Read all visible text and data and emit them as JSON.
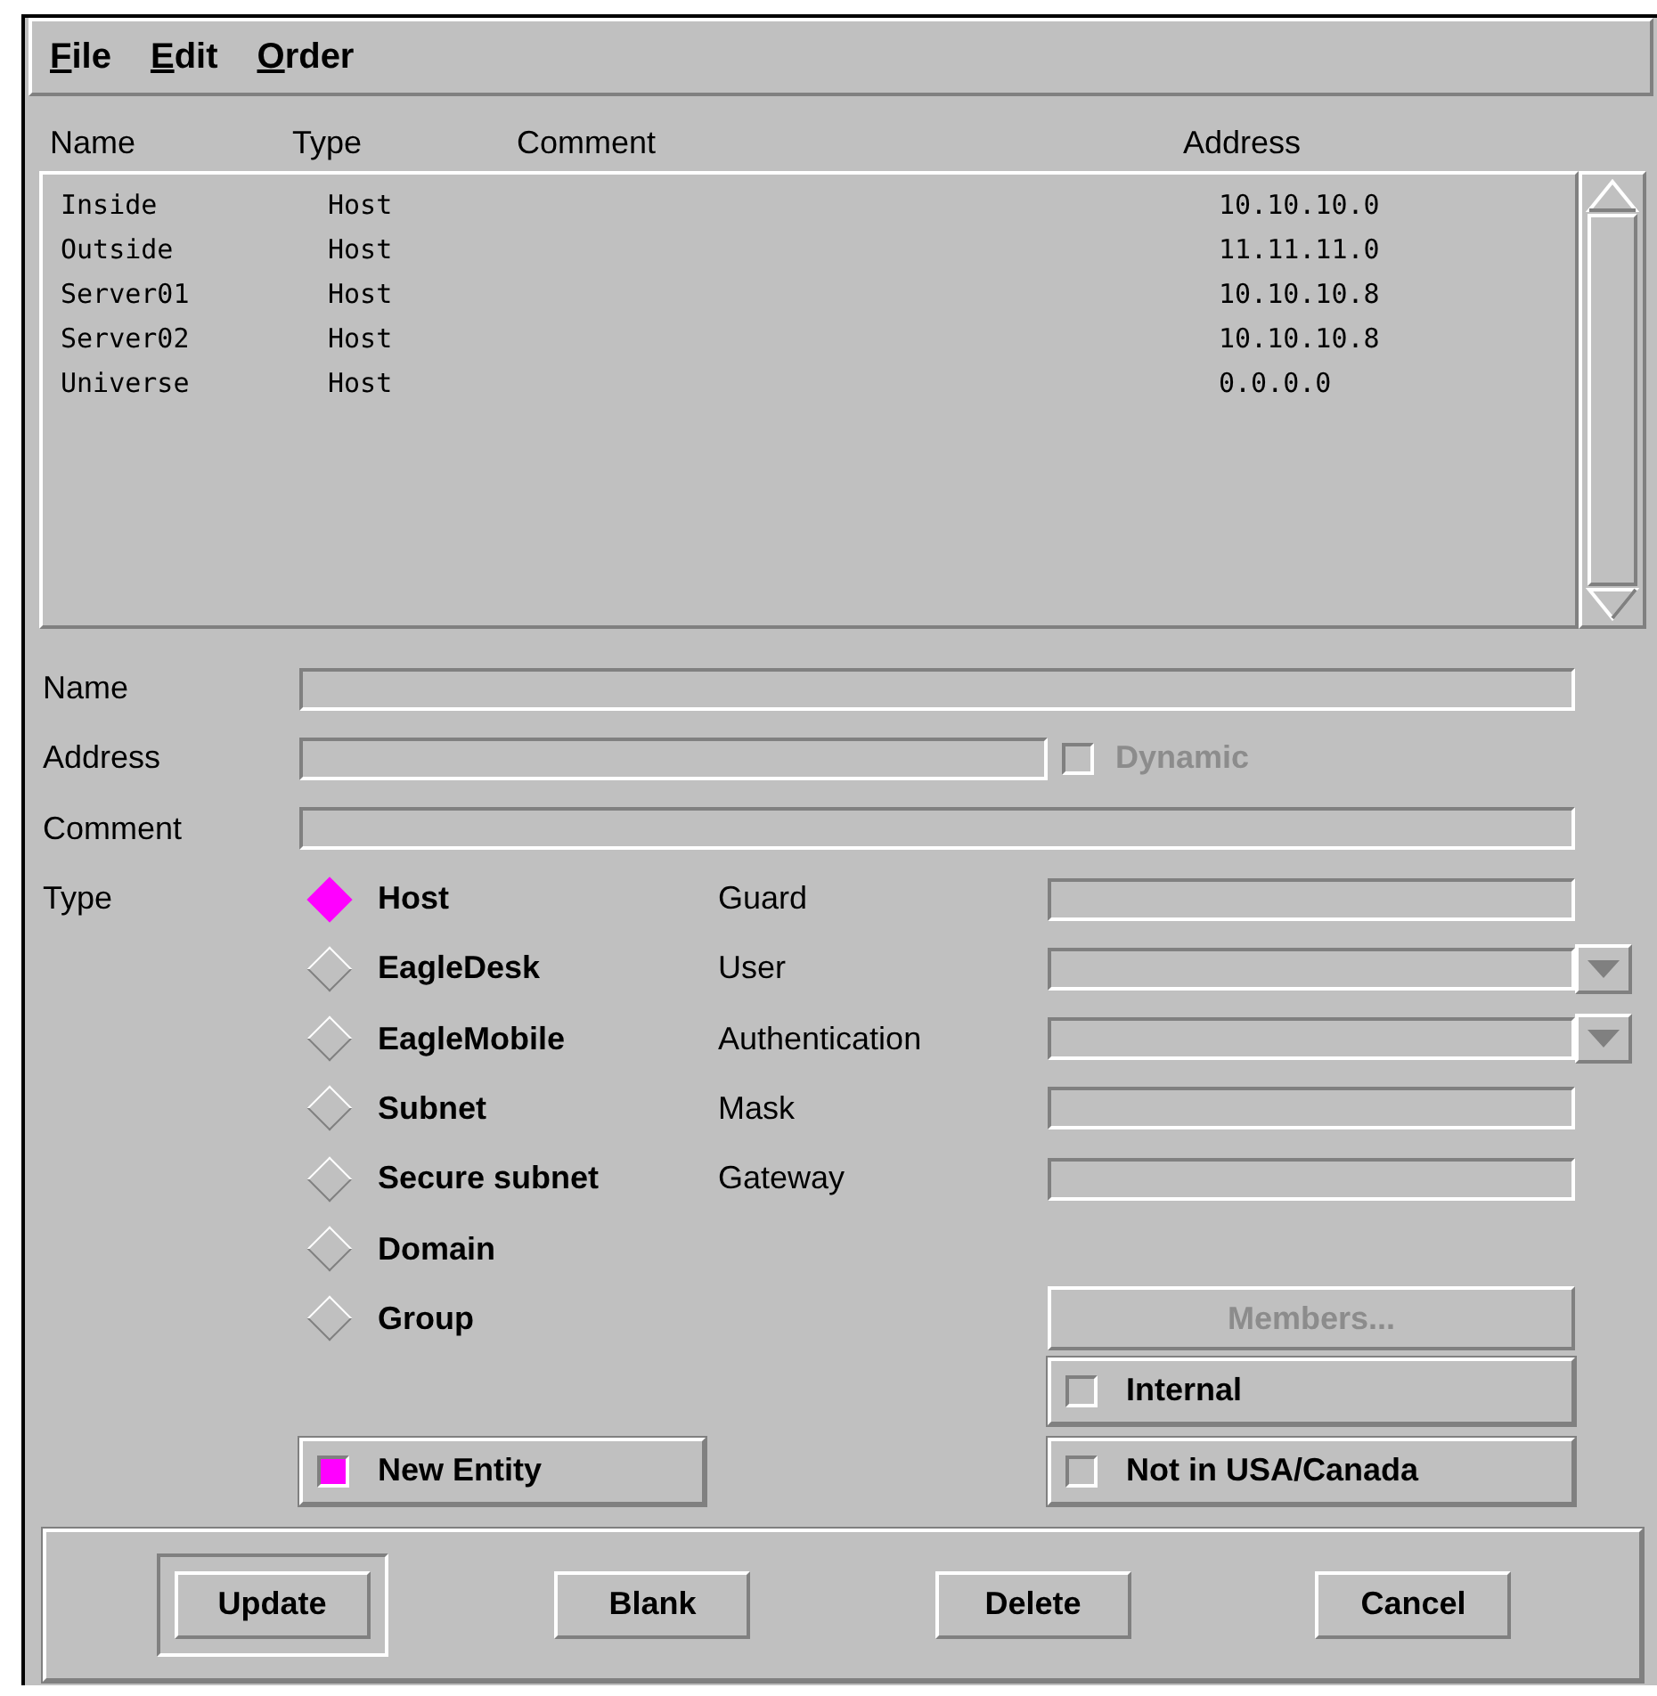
{
  "menu": [
    {
      "label": "File"
    },
    {
      "label": "Edit"
    },
    {
      "label": "Order"
    }
  ],
  "list": {
    "columns": [
      "Name",
      "Type",
      "Comment",
      "Address"
    ],
    "rows": [
      {
        "name": "Inside",
        "type": "Host",
        "address": "10.10.10.0"
      },
      {
        "name": "Outside",
        "type": "Host",
        "address": "11.11.11.0"
      },
      {
        "name": "Server01",
        "type": "Host",
        "address": "10.10.10.8"
      },
      {
        "name": "Server02",
        "type": "Host",
        "address": "10.10.10.8"
      },
      {
        "name": "Universe",
        "type": "Host",
        "address": "0.0.0.0"
      }
    ]
  },
  "name_field": {
    "label": "Name"
  },
  "address_field": {
    "label": "Address"
  },
  "dynamic": {
    "label": "Dynamic",
    "checked": false,
    "disabled": true
  },
  "comment_field": {
    "label": "Comment"
  },
  "type": {
    "label": "Type",
    "options": [
      {
        "label": "Host",
        "selected": true
      },
      {
        "label": "EagleDesk",
        "selected": false
      },
      {
        "label": "EagleMobile",
        "selected": false
      },
      {
        "label": "Subnet",
        "selected": false
      },
      {
        "label": "Secure subnet",
        "selected": false
      },
      {
        "label": "Domain",
        "selected": false
      },
      {
        "label": "Group",
        "selected": false
      }
    ]
  },
  "details": [
    {
      "label": "Guard",
      "kind": "text"
    },
    {
      "label": "User",
      "kind": "dropdown"
    },
    {
      "label": "Authentication",
      "kind": "dropdown"
    },
    {
      "label": "Mask",
      "kind": "text"
    },
    {
      "label": "Gateway",
      "kind": "text"
    }
  ],
  "members": {
    "label": "Members...",
    "disabled": true
  },
  "internal": {
    "label": "Internal",
    "checked": false
  },
  "new_entity": {
    "label": "New Entity",
    "checked": true
  },
  "not_in_usa": {
    "label": "Not in USA/Canada",
    "checked": false
  },
  "buttons": [
    {
      "label": "Update",
      "default": true
    },
    {
      "label": "Blank",
      "default": false
    },
    {
      "label": "Delete",
      "default": false
    },
    {
      "label": "Cancel",
      "default": false
    }
  ]
}
